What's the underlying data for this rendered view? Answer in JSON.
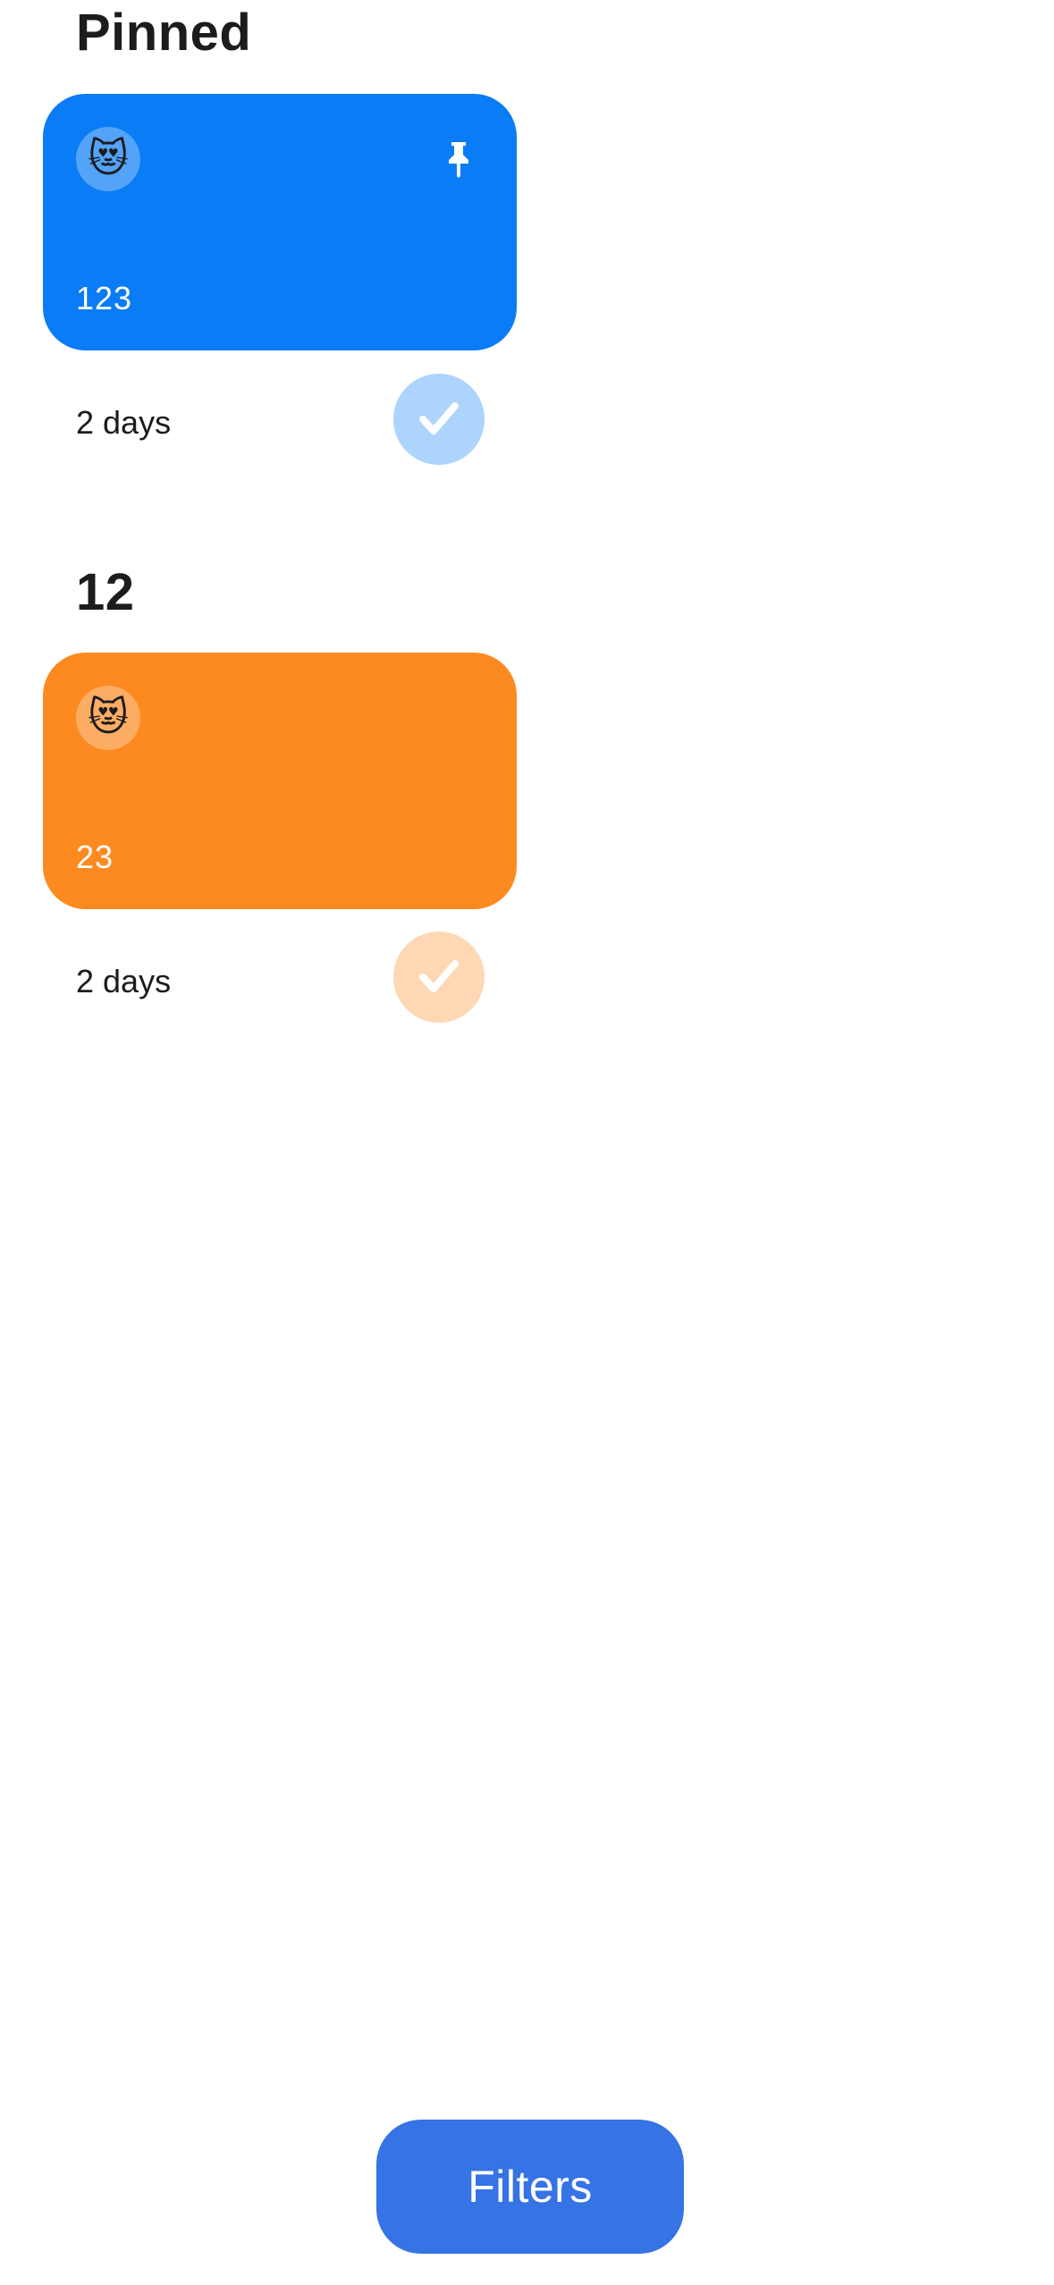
{
  "sections": [
    {
      "title": "Pinned",
      "card": {
        "emoji": "😻",
        "count": "123",
        "color": "#0a7cf5",
        "pinned": true,
        "pin_icon": "pin-icon"
      },
      "duration": "2 days",
      "check_icon": "checkmark-icon"
    },
    {
      "title": "12",
      "card": {
        "emoji": "😻",
        "count": "23",
        "color": "#fd8a20",
        "pinned": false
      },
      "duration": "2 days",
      "check_icon": "checkmark-icon"
    }
  ],
  "filters_button": {
    "label": "Filters",
    "color": "#3673e4"
  }
}
